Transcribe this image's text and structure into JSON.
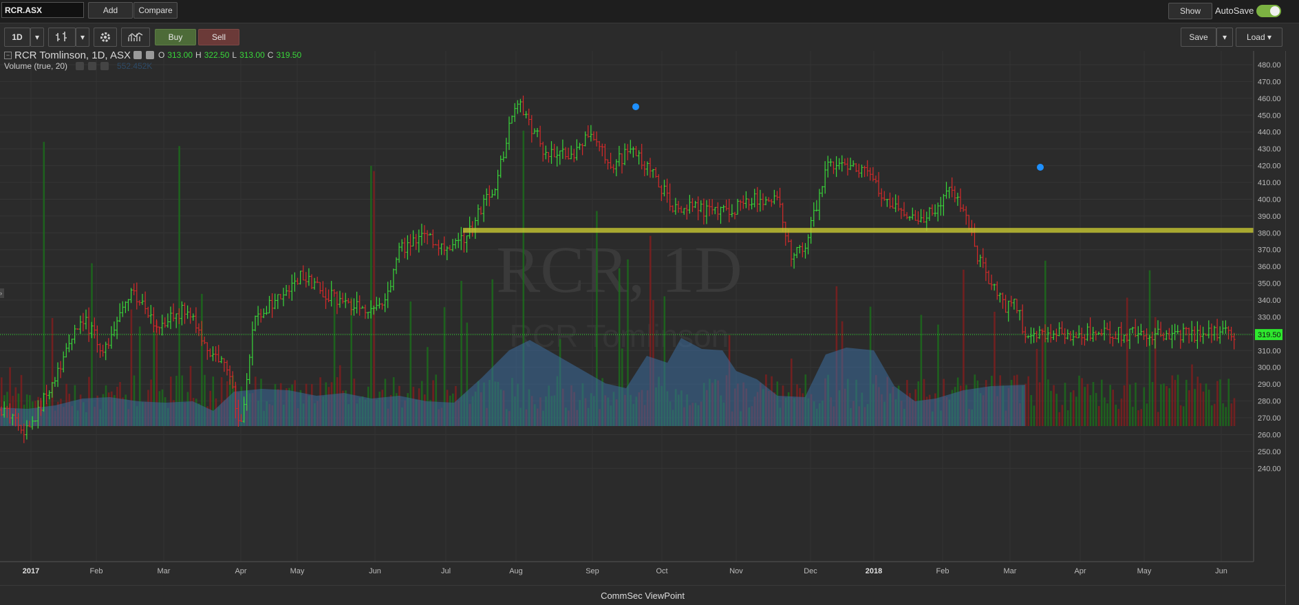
{
  "symbol": "RCR.ASX",
  "top": {
    "add": "Add",
    "compare": "Compare",
    "show": "Show",
    "autosave": "AutoSave"
  },
  "toolbar": {
    "interval": "1D",
    "buy": "Buy",
    "sell": "Sell",
    "save": "Save",
    "load": "Load"
  },
  "legend": {
    "title": "RCR Tomlinson, 1D, ASX",
    "o_label": "O",
    "o": "313.00",
    "h_label": "H",
    "h": "322.50",
    "l_label": "L",
    "l": "313.00",
    "c_label": "C",
    "c": "319.50",
    "volume": "Volume (true, 20)",
    "volume_value": "552.452K"
  },
  "watermark": {
    "line1": "RCR, 1D",
    "line2": "RCR Tomlinson"
  },
  "status": "CommSec ViewPoint",
  "colors": {
    "up": "#39d93a",
    "down": "#d62a2a",
    "price_tag": "#2ee82e",
    "hline": "#c8c832",
    "marker": "#1e90ff",
    "volume_ma": "#3d6e9e"
  },
  "chart_data": {
    "type": "ohlc",
    "y_ticks": [
      "480.00",
      "470.00",
      "460.00",
      "450.00",
      "440.00",
      "430.00",
      "420.00",
      "410.00",
      "400.00",
      "390.00",
      "380.00",
      "370.00",
      "360.00",
      "350.00",
      "340.00",
      "330.00",
      "320.00",
      "310.00",
      "300.00",
      "290.00",
      "280.00",
      "270.00",
      "260.00",
      "250.00",
      "240.00"
    ],
    "ylim": [
      235,
      485
    ],
    "x_labels": [
      "2017",
      "Feb",
      "Mar",
      "Apr",
      "May",
      "Jun",
      "Jul",
      "Aug",
      "Sep",
      "Oct",
      "Nov",
      "Dec",
      "2018",
      "Feb",
      "Mar",
      "Apr",
      "May",
      "Jun"
    ],
    "last_price": "319.50",
    "horizontal_line": 381.5,
    "markers": [
      {
        "date": "Sep",
        "price": 455
      },
      {
        "date": "Mar",
        "price": 419
      }
    ],
    "price_path": [
      [
        0,
        275
      ],
      [
        40,
        262
      ],
      [
        80,
        295
      ],
      [
        120,
        330
      ],
      [
        150,
        310
      ],
      [
        190,
        345
      ],
      [
        230,
        325
      ],
      [
        270,
        335
      ],
      [
        310,
        305
      ],
      [
        330,
        300
      ],
      [
        350,
        265
      ],
      [
        370,
        328
      ],
      [
        400,
        340
      ],
      [
        440,
        355
      ],
      [
        480,
        342
      ],
      [
        510,
        338
      ],
      [
        530,
        333
      ],
      [
        560,
        340
      ],
      [
        580,
        370
      ],
      [
        620,
        378
      ],
      [
        650,
        368
      ],
      [
        680,
        378
      ],
      [
        700,
        395
      ],
      [
        720,
        408
      ],
      [
        750,
        460
      ],
      [
        790,
        430
      ],
      [
        830,
        425
      ],
      [
        860,
        440
      ],
      [
        890,
        420
      ],
      [
        920,
        430
      ],
      [
        950,
        415
      ],
      [
        980,
        395
      ],
      [
        1010,
        395
      ],
      [
        1040,
        392
      ],
      [
        1070,
        395
      ],
      [
        1100,
        400
      ],
      [
        1130,
        400
      ],
      [
        1150,
        368
      ],
      [
        1170,
        370
      ],
      [
        1200,
        418
      ],
      [
        1230,
        420
      ],
      [
        1260,
        415
      ],
      [
        1280,
        405
      ],
      [
        1300,
        395
      ],
      [
        1330,
        388
      ],
      [
        1360,
        392
      ],
      [
        1380,
        405
      ],
      [
        1400,
        396
      ],
      [
        1420,
        365
      ],
      [
        1440,
        350
      ],
      [
        1460,
        335
      ],
      [
        1475,
        340
      ],
      [
        1490,
        320
      ]
    ],
    "volume_ma_path": [
      [
        0,
        27
      ],
      [
        40,
        25
      ],
      [
        80,
        30
      ],
      [
        120,
        40
      ],
      [
        160,
        42
      ],
      [
        200,
        36
      ],
      [
        240,
        34
      ],
      [
        280,
        36
      ],
      [
        310,
        22
      ],
      [
        340,
        50
      ],
      [
        380,
        54
      ],
      [
        420,
        52
      ],
      [
        460,
        44
      ],
      [
        500,
        48
      ],
      [
        540,
        40
      ],
      [
        580,
        44
      ],
      [
        620,
        36
      ],
      [
        660,
        34
      ],
      [
        700,
        70
      ],
      [
        740,
        110
      ],
      [
        770,
        125
      ],
      [
        800,
        108
      ],
      [
        840,
        85
      ],
      [
        880,
        62
      ],
      [
        910,
        55
      ],
      [
        940,
        102
      ],
      [
        970,
        92
      ],
      [
        990,
        128
      ],
      [
        1020,
        112
      ],
      [
        1050,
        110
      ],
      [
        1070,
        80
      ],
      [
        1100,
        68
      ],
      [
        1130,
        44
      ],
      [
        1170,
        42
      ],
      [
        1200,
        104
      ],
      [
        1230,
        114
      ],
      [
        1270,
        110
      ],
      [
        1300,
        58
      ],
      [
        1330,
        36
      ],
      [
        1360,
        40
      ],
      [
        1400,
        52
      ],
      [
        1440,
        58
      ],
      [
        1490,
        60
      ]
    ]
  }
}
